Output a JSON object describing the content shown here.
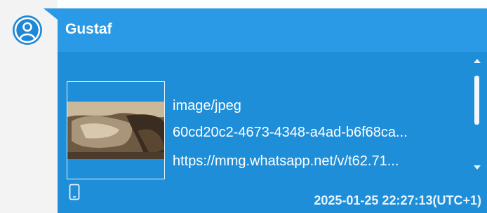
{
  "message": {
    "sender": "Gustaf",
    "attachment": {
      "mime_type": "image/jpeg",
      "file_id": "60cd20c2-4673-4348-a4ad-b6f68ca...",
      "url": "https://mmg.whatsapp.net/v/t62.71..."
    },
    "timestamp": "2025-01-25 22:27:13(UTC+1)"
  },
  "icons": {
    "avatar": "user-avatar-icon",
    "device": "mobile-phone-icon",
    "scroll_up": "chevron-up-icon",
    "scroll_down": "chevron-down-icon"
  },
  "colors": {
    "bubble": "#1f8ed8",
    "header": "#2a9ae6",
    "avatar": "#1e88d6",
    "left_strip": "#f3f3f3"
  }
}
